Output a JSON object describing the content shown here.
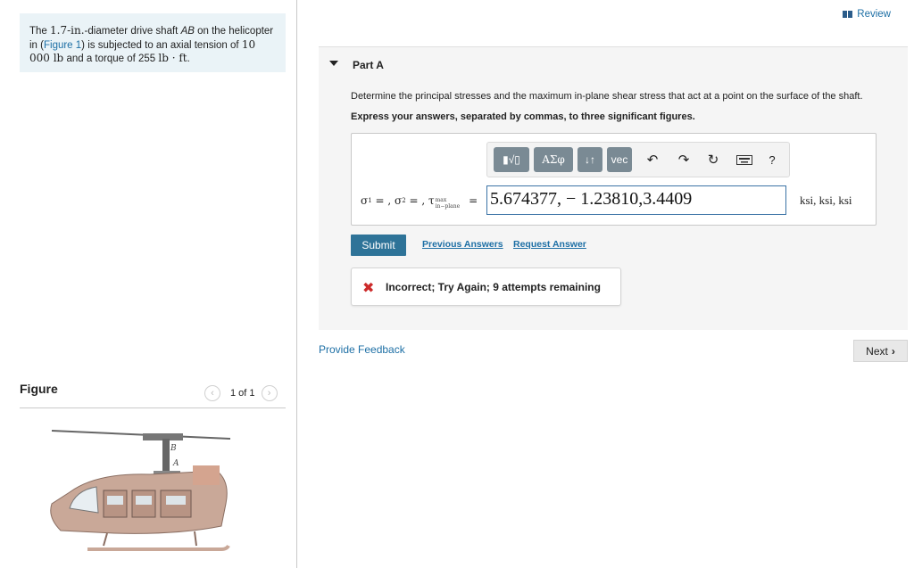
{
  "problem": {
    "text_before": "The ",
    "diameter_value": "1.7-in.",
    "text_mid1": "-diameter drive shaft ",
    "shaft_name": "AB",
    "text_mid2": " on the helicopter in (",
    "figure_link": "Figure 1",
    "text_mid3": ") is subjected to an axial tension of ",
    "tension_value": "10 000 lb",
    "text_mid4": " and a torque of 255 ",
    "torque_unit": "lb · ft",
    "text_end": "."
  },
  "figure": {
    "label": "Figure",
    "count": "1 of 1",
    "prev_icon": "chevron-left-icon",
    "next_icon": "chevron-right-icon",
    "labels": {
      "B": "B",
      "A": "A"
    }
  },
  "header": {
    "review_label": "Review"
  },
  "part": {
    "title": "Part A",
    "question": "Determine the principal stresses and the maximum in-plane shear stress that act at a point on the surface of the shaft.",
    "instruction": "Express your answers, separated by commas, to three significant figures."
  },
  "toolbar": {
    "template_label": "▮√▯",
    "greek_label": "ΑΣφ",
    "arrows_label": "↓↑",
    "vec_label": "vec",
    "help_label": "?"
  },
  "answer": {
    "eq_sigma1": "σ",
    "eq_sigma1_sub": "1",
    "eq_sep1": " = , ",
    "eq_sigma2": "σ",
    "eq_sigma2_sub": "2",
    "eq_sep2": " = , ",
    "eq_tau": "τ",
    "eq_tau_sup": "max",
    "eq_tau_sub": "in−plane",
    "eq_equals": "=",
    "value": "5.674377, − 1.23810,3.4409",
    "units": "ksi, ksi, ksi"
  },
  "actions": {
    "submit_label": "Submit",
    "previous_answers_label": "Previous Answers",
    "request_answer_label": "Request Answer"
  },
  "feedback": {
    "icon": "x-icon",
    "message": "Incorrect; Try Again; 9 attempts remaining",
    "color": "#cc2a2a"
  },
  "footer": {
    "provide_feedback_label": "Provide Feedback",
    "next_label": "Next"
  },
  "colors": {
    "link": "#1d6fa5",
    "submit_bg": "#2e7398",
    "problem_bg": "#eaf3f7",
    "toolbar_btn": "#7a8a94"
  }
}
